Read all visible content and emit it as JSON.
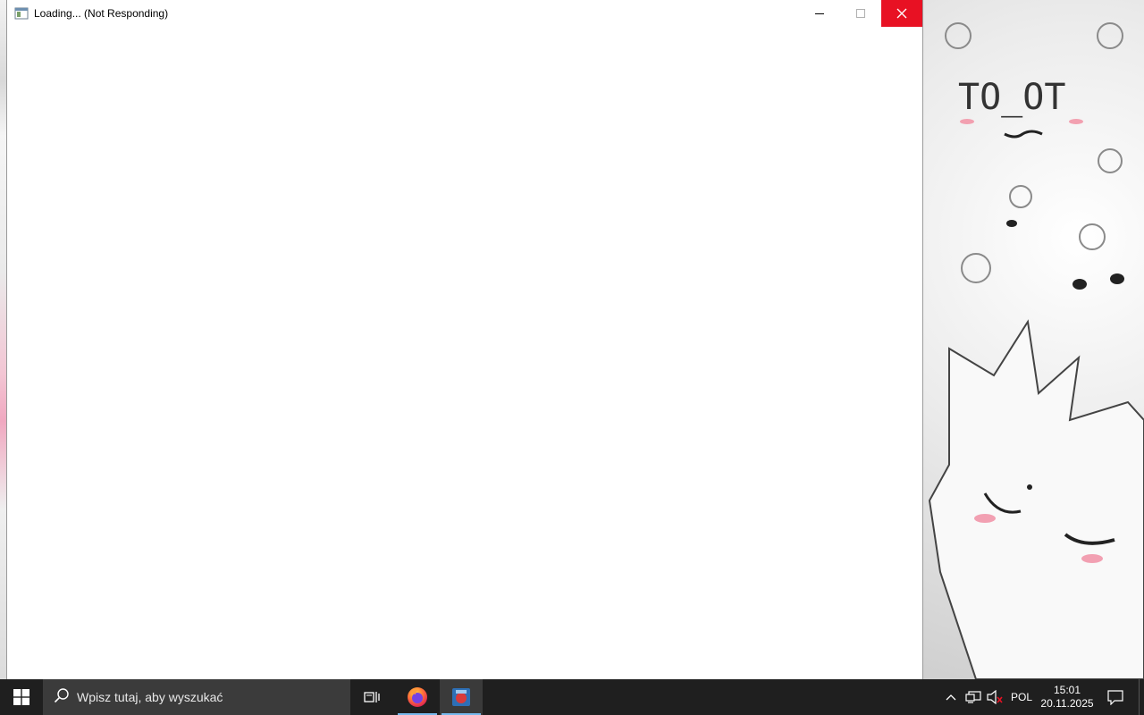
{
  "window": {
    "title": "Loading... (Not Responding)",
    "icon": "app-window-icon"
  },
  "window_controls": {
    "minimize_icon": "minimize-icon",
    "maximize_icon": "maximize-icon",
    "close_icon": "close-icon",
    "close_color": "#e81123"
  },
  "taskbar": {
    "background": "#1f1f1f",
    "start_icon": "windows-logo-icon",
    "search_placeholder": "Wpisz tutaj, aby wyszukać",
    "task_view_icon": "task-view-icon",
    "apps": [
      {
        "name": "Firefox",
        "icon": "firefox-icon",
        "running": true
      },
      {
        "name": "App",
        "icon": "app-icon",
        "running": true,
        "active": true
      }
    ],
    "tray": {
      "chevron_icon": "chevron-up-icon",
      "network_icon": "network-icon",
      "volume_icon": "volume-muted-icon",
      "language": "POL",
      "time": "15:01",
      "date": "20.11.2025",
      "notifications_icon": "notifications-icon"
    }
  },
  "wallpaper": {
    "text": "TO_OT"
  }
}
